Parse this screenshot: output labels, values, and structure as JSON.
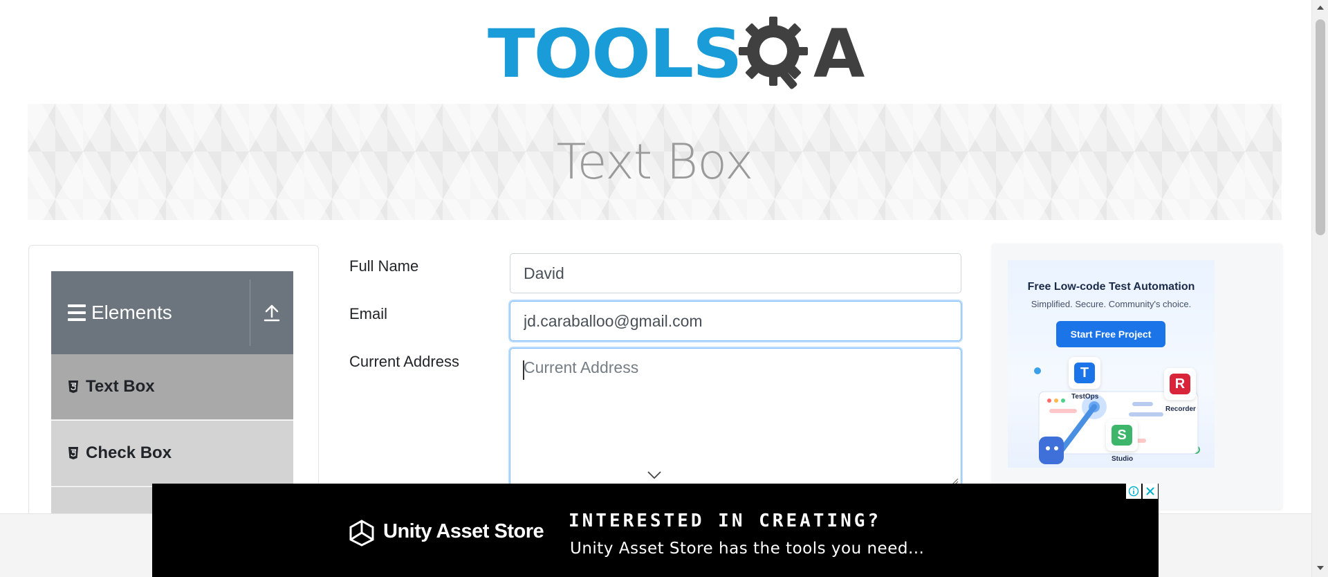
{
  "header": {
    "logo_text": "TOOLS",
    "logo_suffix": "A"
  },
  "banner": {
    "title": "Text Box"
  },
  "sidebar": {
    "group_title": "Elements",
    "items": [
      {
        "label": "Text Box",
        "active": true
      },
      {
        "label": "Check Box",
        "active": false
      }
    ]
  },
  "form": {
    "full_name": {
      "label": "Full Name",
      "value": "David"
    },
    "email": {
      "label": "Email",
      "value": "jd.caraballoo@gmail.com"
    },
    "current_address": {
      "label": "Current Address",
      "value": "",
      "placeholder": "Current Address"
    }
  },
  "right_ad": {
    "title": "Free Low-code Test Automation",
    "subtitle": "Simplified. Secure. Community's choice.",
    "button_label": "Start Free Project",
    "cards": [
      "TestOps",
      "Recorder",
      "Studio"
    ]
  },
  "bottom_ad": {
    "brand": "Unity Asset Store",
    "headline": "INTERESTED IN CREATING?",
    "subline": "Unity Asset Store has the tools you need..."
  },
  "colors": {
    "brand_blue": "#1a9cd8",
    "sidebar_header": "#6c757d",
    "active_item": "#a9a9a9",
    "inactive_item": "#d3d3d3",
    "focus_border": "#80bdff",
    "ad_button": "#1b74e8"
  }
}
